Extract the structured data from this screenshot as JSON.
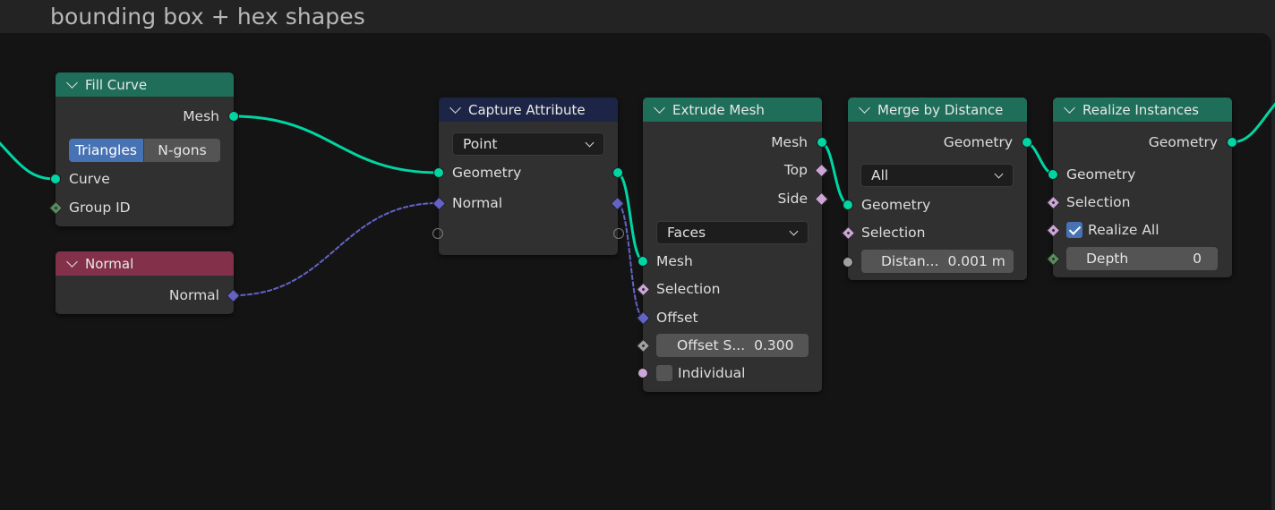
{
  "frame": {
    "label": "bounding box + hex shapes"
  },
  "colors": {
    "geometry_socket": "#00d6a3",
    "vector_socket": "#6363c7",
    "boolean_socket": "#cca6d6",
    "float_socket": "#a1a1a1",
    "integer_socket": "#598c5c",
    "geometry_header": "#1e6e5a",
    "input_header": "#83314a",
    "attribute_header": "#1d2546",
    "accent_blue": "#4772b3"
  },
  "nodes": {
    "fill_curve": {
      "title": "Fill Curve",
      "outputs": {
        "mesh": "Mesh"
      },
      "mode_options": [
        "Triangles",
        "N-gons"
      ],
      "mode_selected": "Triangles",
      "inputs": {
        "curve": "Curve",
        "group_id": "Group ID"
      }
    },
    "normal": {
      "title": "Normal",
      "outputs": {
        "normal": "Normal"
      }
    },
    "capture_attribute": {
      "title": "Capture Attribute",
      "domain": "Point",
      "items": {
        "geometry": "Geometry",
        "normal": "Normal"
      }
    },
    "extrude_mesh": {
      "title": "Extrude Mesh",
      "outputs": {
        "mesh": "Mesh",
        "top": "Top",
        "side": "Side"
      },
      "mode": "Faces",
      "inputs": {
        "mesh": "Mesh",
        "selection": "Selection",
        "offset": "Offset",
        "offset_scale_label": "Offset S...",
        "offset_scale_value": "0.300",
        "individual": "Individual"
      },
      "individual_checked": false
    },
    "merge_by_distance": {
      "title": "Merge by Distance",
      "outputs": {
        "geometry": "Geometry"
      },
      "mode": "All",
      "inputs": {
        "geometry": "Geometry",
        "selection": "Selection",
        "distance_label": "Distan...",
        "distance_value": "0.001 m"
      }
    },
    "realize_instances": {
      "title": "Realize Instances",
      "outputs": {
        "geometry": "Geometry"
      },
      "inputs": {
        "geometry": "Geometry",
        "selection": "Selection",
        "realize_all": "Realize All",
        "depth_label": "Depth",
        "depth_value": "0"
      },
      "realize_all_checked": true
    }
  }
}
